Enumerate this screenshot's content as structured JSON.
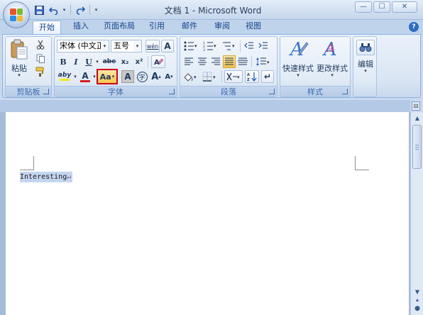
{
  "window": {
    "title": "文档 1 - Microsoft Word",
    "minimize": "—",
    "maximize": "☐",
    "close": "✕"
  },
  "qat": {
    "save_icon": "save-icon",
    "undo_icon": "undo-icon",
    "redo_icon": "redo-icon"
  },
  "tabs": [
    {
      "label": "开始",
      "active": true
    },
    {
      "label": "插入"
    },
    {
      "label": "页面布局"
    },
    {
      "label": "引用"
    },
    {
      "label": "邮件"
    },
    {
      "label": "审阅"
    },
    {
      "label": "视图"
    }
  ],
  "help_label": "?",
  "groups": {
    "clipboard": {
      "label": "剪贴板",
      "paste_label": "粘贴"
    },
    "font": {
      "label": "字体",
      "font_name": "宋体 (中文正文",
      "font_size": "五号",
      "bold": "B",
      "italic": "I",
      "underline": "U",
      "strikethrough": "abe",
      "subscript": "x₂",
      "superscript": "x²",
      "highlight": "aby",
      "font_color": "A",
      "change_case": "Aa",
      "char_shading": "A",
      "enclose_char": "字",
      "grow_font": "A",
      "shrink_font": "A",
      "phonetic": "wén"
    },
    "paragraph": {
      "label": "段落"
    },
    "styles": {
      "label": "样式",
      "quick_styles": "快速样式",
      "change_styles": "更改样式"
    },
    "editing": {
      "label": "编辑"
    }
  },
  "document": {
    "text": "Interesting",
    "para_mark": "↵"
  },
  "colors": {
    "highlight": "#f5e61e",
    "font_color": "#d81e1e",
    "selection": "#c4d5ef",
    "focus_border": "#d0021b"
  }
}
